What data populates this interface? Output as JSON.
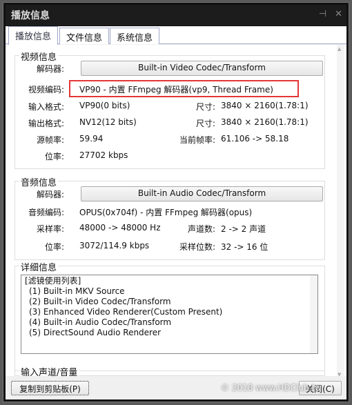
{
  "window": {
    "title": "播放信息",
    "pin_icon": "pin-icon",
    "close_icon": "close-icon"
  },
  "tabs": [
    "播放信息",
    "文件信息",
    "系统信息"
  ],
  "video": {
    "title": "视频信息",
    "decoder_label": "解码器:",
    "decoder": "Built-in Video Codec/Transform",
    "codec_label": "视频编码:",
    "codec": "VP90 - 内置 FFmpeg 解码器(vp9, Thread Frame)",
    "input_label": "输入格式:",
    "input": "VP90(0 bits)",
    "size_label": "尺寸:",
    "size": "3840 × 2160(1.78:1)",
    "output_label": "输出格式:",
    "output": "NV12(12 bits)",
    "size2_label": "尺寸:",
    "size2": "3840 × 2160(1.78:1)",
    "fps_label": "源帧率:",
    "fps": "59.94",
    "cur_fps_label": "当前帧率:",
    "cur_fps": "61.106 -> 58.18",
    "bitrate_label": "位率:",
    "bitrate": "27702 kbps"
  },
  "audio": {
    "title": "音频信息",
    "decoder_label": "解码器:",
    "decoder": "Built-in Audio Codec/Transform",
    "codec_label": "音频编码:",
    "codec": "OPUS(0x704f) - 内置 FFmpeg 解码器(opus)",
    "rate_label": "采样率:",
    "rate": "48000 -> 48000 Hz",
    "ch_label": "声道数:",
    "ch": "2 -> 2 声道",
    "bitrate_label": "位率:",
    "bitrate": "3072/114.9 kbps",
    "bits_label": "采样位数:",
    "bits": "32 -> 16 位"
  },
  "details": {
    "title": "详细信息",
    "items": [
      "[滤镜使用列表]",
      "(1) Built-in MKV Source",
      "(2) Built-in Video Codec/Transform",
      "(3) Enhanced Video Renderer(Custom Present)",
      "(4) Built-in Audio Codec/Transform",
      "(5) DirectSound Audio Renderer"
    ]
  },
  "volume": {
    "title": "输入声道/音量"
  },
  "buttons": {
    "copy": "复制到剪贴板(P)",
    "close": "关闭(C)"
  },
  "watermark": "© 2018 www.HDClub.tw",
  "colors": {
    "highlight": "#e53535",
    "titlebar": "#1c1c1c"
  }
}
